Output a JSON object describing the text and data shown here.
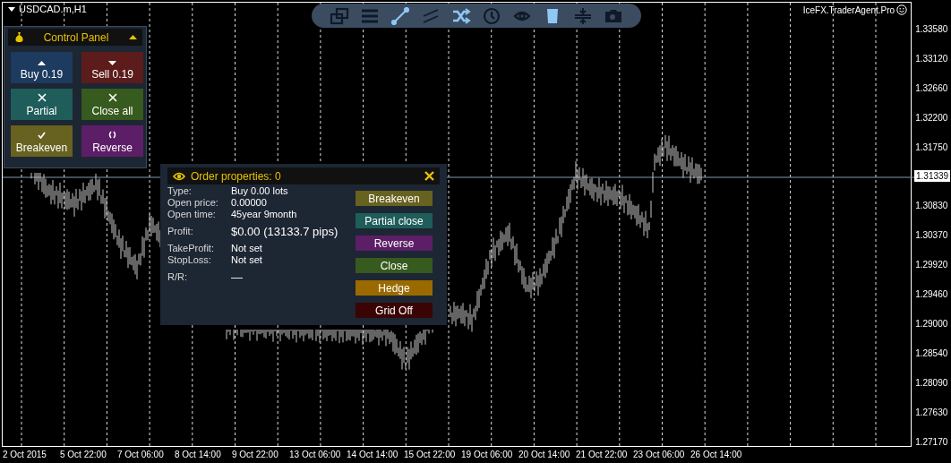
{
  "chart": {
    "symbol": "USDCAD.m,H1",
    "expert": "IceFX.TraderAgent.Pro",
    "current_price": "1.31339"
  },
  "toolbar": [
    {
      "kind": "windows",
      "highlighted": false
    },
    {
      "kind": "lines",
      "highlighted": false
    },
    {
      "kind": "trendline",
      "highlighted": true
    },
    {
      "kind": "channel",
      "highlighted": false
    },
    {
      "kind": "shuffle",
      "highlighted": true
    },
    {
      "kind": "clock",
      "highlighted": false
    },
    {
      "kind": "eye",
      "highlighted": false
    },
    {
      "kind": "bin",
      "highlighted": true
    },
    {
      "kind": "split",
      "highlighted": false
    },
    {
      "kind": "camera",
      "highlighted": false
    }
  ],
  "control_panel": {
    "title": "Control Panel",
    "buttons": [
      {
        "label": "Buy 0.19",
        "kind": "up",
        "color": "#1d3a5f"
      },
      {
        "label": "Sell 0.19",
        "kind": "down",
        "color": "#5c1c1c"
      },
      {
        "label": "Partial",
        "kind": "cross",
        "color": "#1e5d5a"
      },
      {
        "label": "Close all",
        "kind": "cross",
        "color": "#375a1e"
      },
      {
        "label": "Breakeven",
        "kind": "check",
        "color": "#67621f"
      },
      {
        "label": "Reverse",
        "kind": "swap",
        "color": "#5c1e66"
      }
    ]
  },
  "order_properties": {
    "title": "Order properties: 0",
    "fields": [
      {
        "label": "Type:",
        "value": "Buy  0.00 lots",
        "kind": "plain"
      },
      {
        "label": "Open price:",
        "value": "0.00000",
        "kind": "plain"
      },
      {
        "label": "Open time:",
        "value": "45year 9month",
        "kind": "plain"
      },
      {
        "label": "Profit:",
        "value": "$0.00 (13133.7 pips)",
        "kind": "large"
      },
      {
        "label": "TakeProfit:",
        "value": "Not set",
        "kind": "plain"
      },
      {
        "label": "StopLoss:",
        "value": "Not set",
        "kind": "plain"
      },
      {
        "label": "R/R:",
        "value": "—",
        "kind": "large"
      }
    ],
    "buttons": [
      {
        "label": "Breakeven",
        "color": "#67621f"
      },
      {
        "label": "Partial close",
        "color": "#1e5d5a"
      },
      {
        "label": "Reverse",
        "color": "#5c1e66"
      },
      {
        "label": "Close",
        "color": "#375a1e"
      },
      {
        "label": "Hedge",
        "color": "#9a6a00"
      },
      {
        "label": "Grid Off",
        "color": "#3a0404"
      }
    ]
  },
  "price_axis": [
    "1.33580",
    "1.33120",
    "1.32660",
    "1.32200",
    "1.31750",
    "1.30830",
    "1.30370",
    "1.29920",
    "1.29460",
    "1.29000",
    "1.28540",
    "1.28090",
    "1.27630",
    "1.27170"
  ],
  "time_axis": [
    "2 Oct 2015",
    "5 Oct 22:00",
    "7 Oct 06:00",
    "8 Oct 14:00",
    "9 Oct 22:00",
    "13 Oct 06:00",
    "14 Oct 14:00",
    "15 Oct 22:00",
    "19 Oct 06:00",
    "20 Oct 14:00",
    "21 Oct 22:00",
    "23 Oct 06:00",
    "26 Oct 14:00"
  ]
}
